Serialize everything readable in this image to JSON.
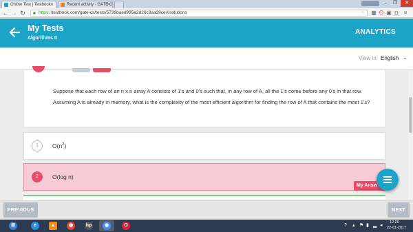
{
  "browser": {
    "tabs": [
      {
        "title": "Online Test | Testbook",
        "active": true
      },
      {
        "title": "Recent activity - GATE O",
        "active": false
      }
    ],
    "user_badge": "",
    "url_scheme": "https://",
    "url_rest": "testbook.com/gate-cs/tests/5739baed995a2d26c9aa39ce#/solutions"
  },
  "header": {
    "title": "My Tests",
    "subtitle": "Algorithms II",
    "analytics_label": "ANALYTICS",
    "color": "#1ba3c8"
  },
  "language": {
    "view_in_label": "View in:",
    "selected": "English"
  },
  "question": {
    "text": "Suppose that each row of an n x n array A consists of 1's and 0's such that, in any row of A, all the 1's come before any 0's in that row. Assuming A is already in memory, what is the complexity of the most efficient algorithm for finding the row of A that contains the most 1's?"
  },
  "options": [
    {
      "number": "1",
      "text_base": "O(n",
      "text_sup": "2",
      "text_end": ")",
      "state": "neutral"
    },
    {
      "number": "2",
      "text": "O(log n)",
      "state": "selected-wrong"
    }
  ],
  "my_answer_label": "My Answ",
  "footer": {
    "previous_label": "PREVIOUS",
    "next_label": "NEXT"
  },
  "taskbar": {
    "icons": [
      "start-orb-icon",
      "file-explorer-icon",
      "internet-explorer-icon",
      "vlc-icon",
      "chrome-icon",
      "hp-icon",
      "chrome-active-icon",
      "opera-icon"
    ],
    "time": "12:20",
    "date": "22-01-2017"
  },
  "colors": {
    "accent": "#1ba3c8",
    "wrong": "#e84d68",
    "wrong_bg": "#f6cbd5",
    "correct": "#7ccd7c"
  }
}
